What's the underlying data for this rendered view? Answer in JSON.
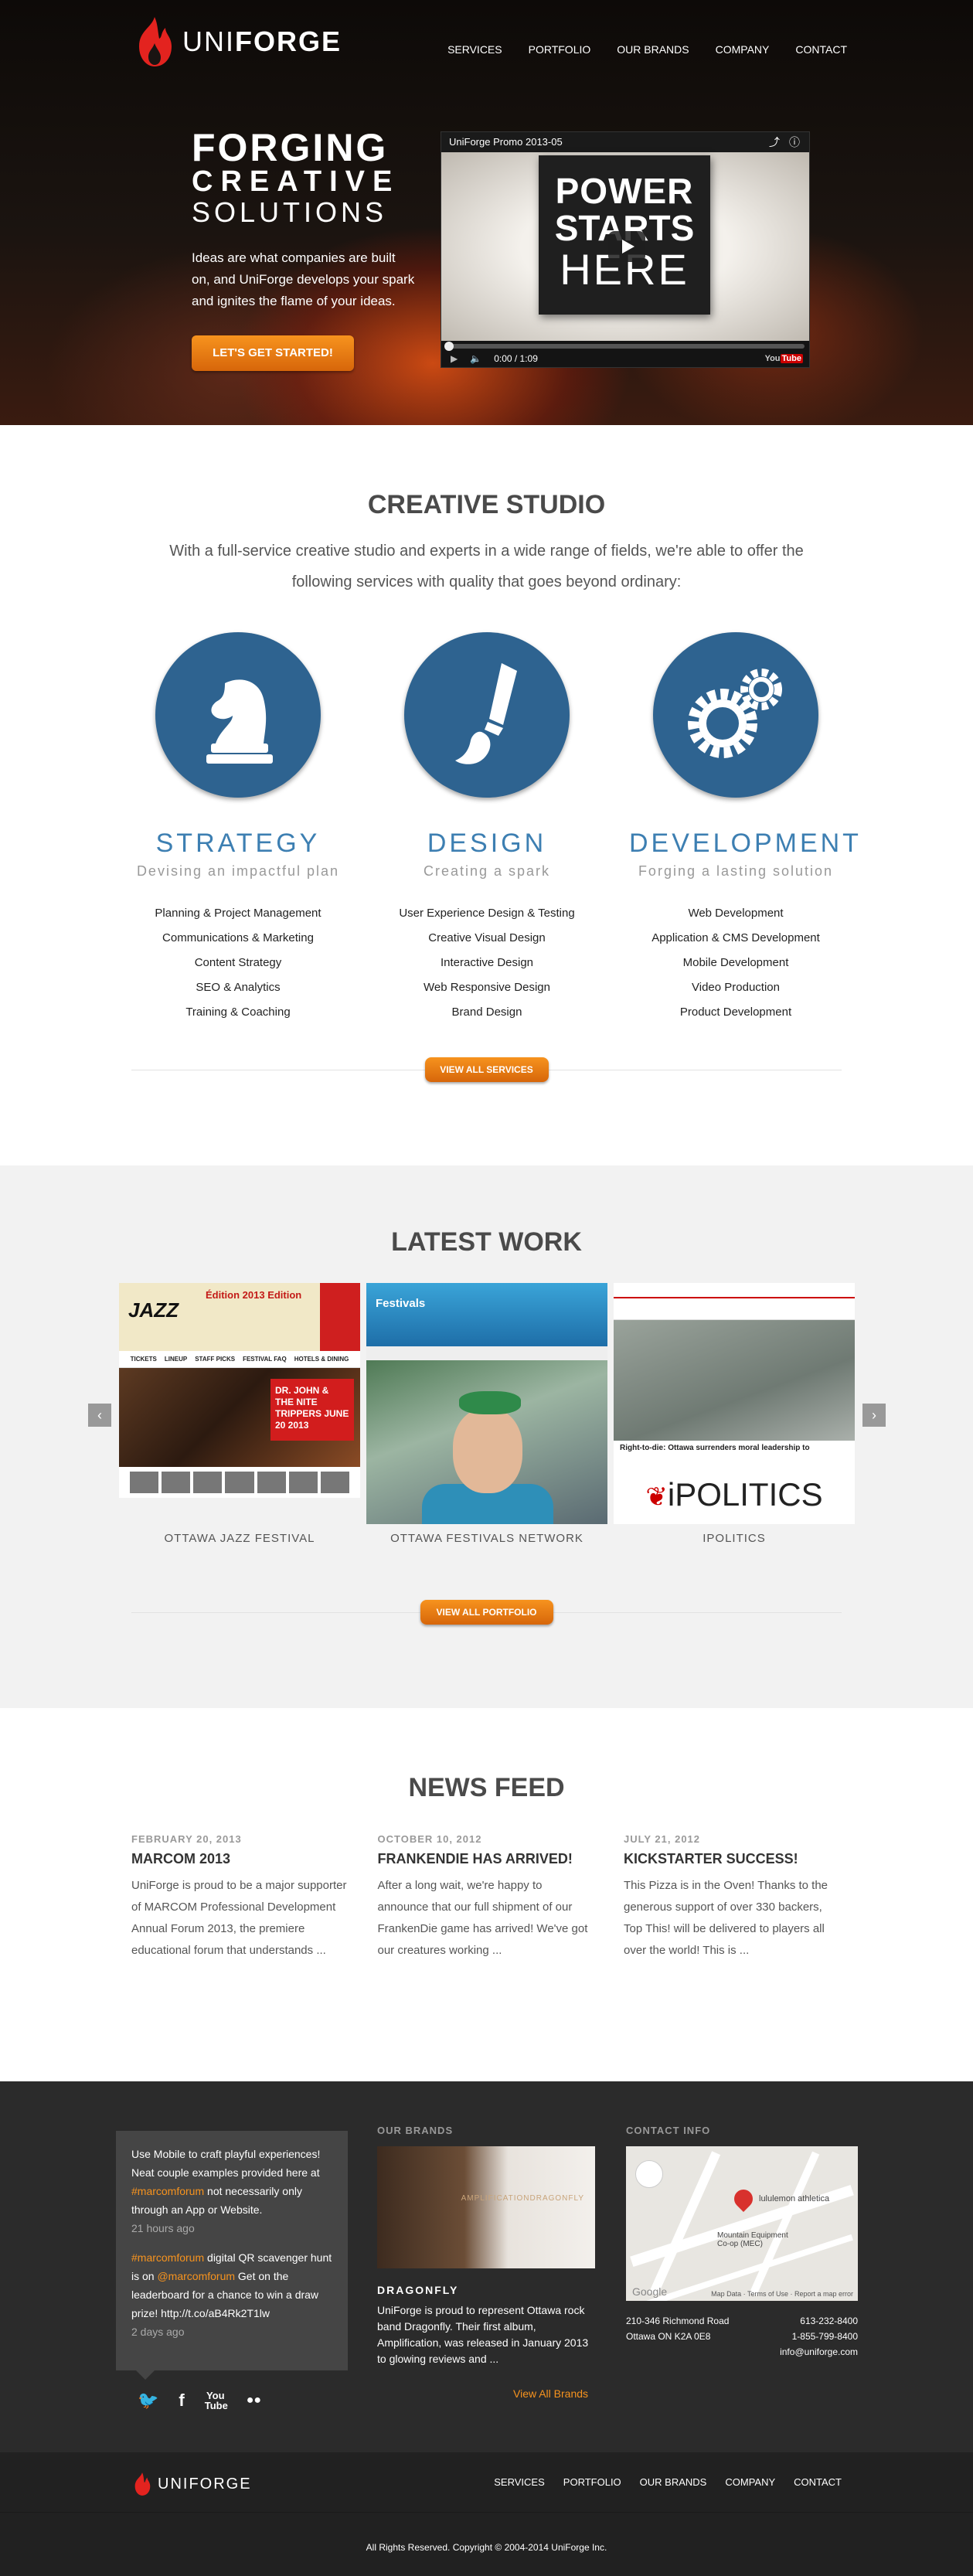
{
  "header": {
    "logo_part1": "UNI",
    "logo_part2": "FORGE",
    "nav": [
      "SERVICES",
      "PORTFOLIO",
      "OUR BRANDS",
      "COMPANY",
      "CONTACT"
    ]
  },
  "hero": {
    "line1": "FORGING",
    "line2": "CREATIVE",
    "line3": "SOLUTIONS",
    "text": "Ideas are what companies are built on, and UniForge develops your spark and ignites the flame of your ideas.",
    "cta": "LET'S GET STARTED!",
    "video": {
      "title": "UniForge Promo 2013-05",
      "card_line1": "POWER",
      "card_line2": "STARTS",
      "card_line3": "HERE",
      "time": "0:00 / 1:09",
      "progress": 0,
      "brand": "You Tube",
      "icons": [
        "share-icon",
        "info-icon",
        "play-icon",
        "volume-icon"
      ]
    }
  },
  "studio": {
    "title": "CREATIVE STUDIO",
    "intro": "With a full-service creative studio and experts in a wide range of fields, we're able to offer the following services with quality that goes beyond ordinary:",
    "services": [
      {
        "title": "STRATEGY",
        "subtitle": "Devising an impactful plan",
        "icon": "knight-icon",
        "items": [
          "Planning & Project Management",
          "Communications & Marketing",
          "Content Strategy",
          "SEO & Analytics",
          "Training & Coaching"
        ]
      },
      {
        "title": "DESIGN",
        "subtitle": "Creating a spark",
        "icon": "brush-icon",
        "items": [
          "User Experience Design & Testing",
          "Creative Visual Design",
          "Interactive Design",
          "Web Responsive Design",
          "Brand Design"
        ]
      },
      {
        "title": "DEVELOPMENT",
        "subtitle": "Forging a lasting solution",
        "icon": "gears-icon",
        "items": [
          "Web Development",
          "Application & CMS Development",
          "Mobile Development",
          "Video Production",
          "Product Development"
        ]
      }
    ],
    "cta": "VIEW ALL SERVICES"
  },
  "work": {
    "title": "LATEST WORK",
    "slides": [
      {
        "caption": "OTTAWA JAZZ FESTIVAL",
        "logo": "JAZZ",
        "edition": "Édition 2013 Edition",
        "nav": [
          "TICKETS",
          "LINEUP",
          "STAFF PICKS",
          "FESTIVAL FAQ",
          "HOTELS & DINING"
        ],
        "badge": "DR. JOHN & THE NITE TRIPPERS JUNE 20 2013"
      },
      {
        "caption": "OTTAWA FESTIVALS NETWORK",
        "logo": "Festivals"
      },
      {
        "caption": "IPOLITICS",
        "headline": "Right-to-die: Ottawa surrenders moral leadership to",
        "logo": "iPOLITICS"
      }
    ],
    "prev": "‹",
    "next": "›",
    "cta": "VIEW ALL PORTFOLIO"
  },
  "news": {
    "title": "NEWS FEED",
    "items": [
      {
        "date": "FEBRUARY 20, 2013",
        "title": "MARCOM 2013",
        "body": "UniForge is proud to be a major supporter of MARCOM Professional Development Annual Forum 2013, the premiere educational forum that understands ..."
      },
      {
        "date": "OCTOBER 10, 2012",
        "title": "FRANKENDIE HAS ARRIVED!",
        "body": "After a long wait, we're happy to announce that our full shipment of our FrankenDie game has arrived! We've got our creatures working ..."
      },
      {
        "date": "JULY 21, 2012",
        "title": "KICKSTARTER SUCCESS!",
        "body": "This Pizza is in the Oven! Thanks to the generous support of over 330 backers, Top This! will be delivered to players all over the world! This is ..."
      }
    ]
  },
  "footer": {
    "tweets": [
      {
        "pre": "Use Mobile to craft playful experiences! Neat couple examples provided here at ",
        "tag": "#marcomforum",
        "post": " not necessarily only through an App or Website.",
        "time": "21 hours ago"
      },
      {
        "tag": "#marcomforum",
        "mid": " digital QR scavenger hunt is on ",
        "mention": "@marcomforum",
        "post": " Get on the leaderboard for a chance to win a draw prize! http://t.co/aB4Rk2T1lw",
        "time": "2 days ago"
      }
    ],
    "social": [
      "twitter-icon",
      "facebook-icon",
      "youtube-icon",
      "flickr-icon"
    ],
    "social_labels": [
      "🐦",
      "f",
      "You Tube",
      "●●"
    ],
    "brands_head": "OUR BRANDS",
    "brand_img_text": "AMPLIFICATIONDRAGONFLY",
    "brand_name": "DRAGONFLY",
    "brand_text": "UniForge is proud to represent Ottawa rock band Dragonfly. Their first album, Amplification, was released in January 2013 to glowing reviews and ...",
    "brand_link": "View All Brands",
    "contact_head": "CONTACT INFO",
    "map_labels": [
      "lululemon athletica",
      "Mountain Equipment Co-op (MEC)",
      "Google",
      "Map Data",
      "Terms of Use",
      "Report a map error"
    ],
    "address1": "210-346 Richmond Road",
    "address2": "Ottawa ON K2A 0E8",
    "phone1": "613-232-8400",
    "phone2": "1-855-799-8400",
    "email": "info@uniforge.com",
    "bottom_logo": "UNIFORGE",
    "bottom_nav": [
      "SERVICES",
      "PORTFOLIO",
      "OUR BRANDS",
      "COMPANY",
      "CONTACT"
    ],
    "copyright": "All Rights Reserved. Copyright © 2004-2014 UniForge Inc."
  },
  "colors": {
    "accent_orange": "#f7931e",
    "service_blue": "#2e6390",
    "title_blue": "#3d7fb2",
    "footer_dark": "#2b2b2b"
  }
}
